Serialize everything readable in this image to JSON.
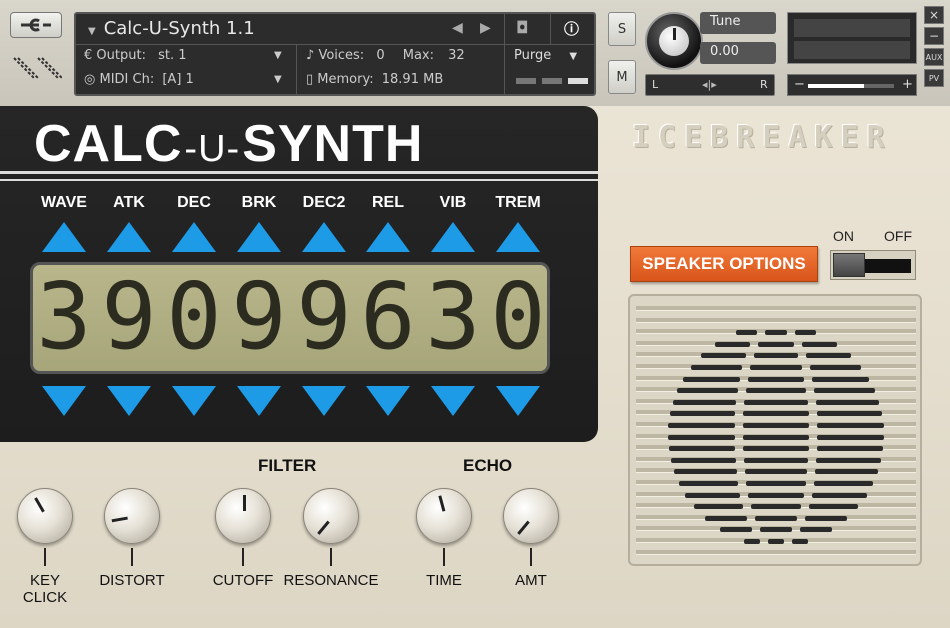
{
  "header": {
    "instrument_name": "Calc-U-Synth 1.1",
    "output_label": "Output:",
    "output_value": "st. 1",
    "voices_label": "Voices:",
    "voices_value": "0",
    "max_label": "Max:",
    "max_value": "32",
    "midi_label": "MIDI Ch:",
    "midi_value": "[A] 1",
    "memory_label": "Memory:",
    "memory_value": "18.91 MB",
    "purge_label": "Purge",
    "solo_label": "S",
    "mute_label": "M",
    "tune_label": "Tune",
    "tune_value": "0.00",
    "pan_left": "L",
    "pan_right": "R",
    "vol_minus": "−",
    "vol_plus": "+",
    "aux_label": "AUX",
    "pv_label": "PV",
    "close_label": "×",
    "min_label": "−"
  },
  "logo": {
    "left": "CALC",
    "middle": "-U-",
    "right": "SYNTH"
  },
  "params": [
    "WAVE",
    "ATK",
    "DEC",
    "BRK",
    "DEC2",
    "REL",
    "VIB",
    "TREM"
  ],
  "lcd_digits": [
    "3",
    "9",
    "0",
    "9",
    "9",
    "6",
    "3",
    "0"
  ],
  "sections": {
    "filter": "FILTER",
    "echo": "ECHO"
  },
  "knobs": [
    {
      "label": "KEY CLICK",
      "rotation_deg": -30
    },
    {
      "label": "DISTORT",
      "rotation_deg": -100
    },
    {
      "label": "CUTOFF",
      "rotation_deg": 0
    },
    {
      "label": "RESONANCE",
      "rotation_deg": -140
    },
    {
      "label": "TIME",
      "rotation_deg": -15
    },
    {
      "label": "AMT",
      "rotation_deg": -140
    }
  ],
  "brand": "ICEBREAKER",
  "speaker": {
    "button_label": "SPEAKER OPTIONS",
    "on_label": "ON",
    "off_label": "OFF"
  },
  "colors": {
    "accent_blue": "#1e9be6",
    "speaker_orange": "#e5642a",
    "lcd": "#b1af84"
  }
}
